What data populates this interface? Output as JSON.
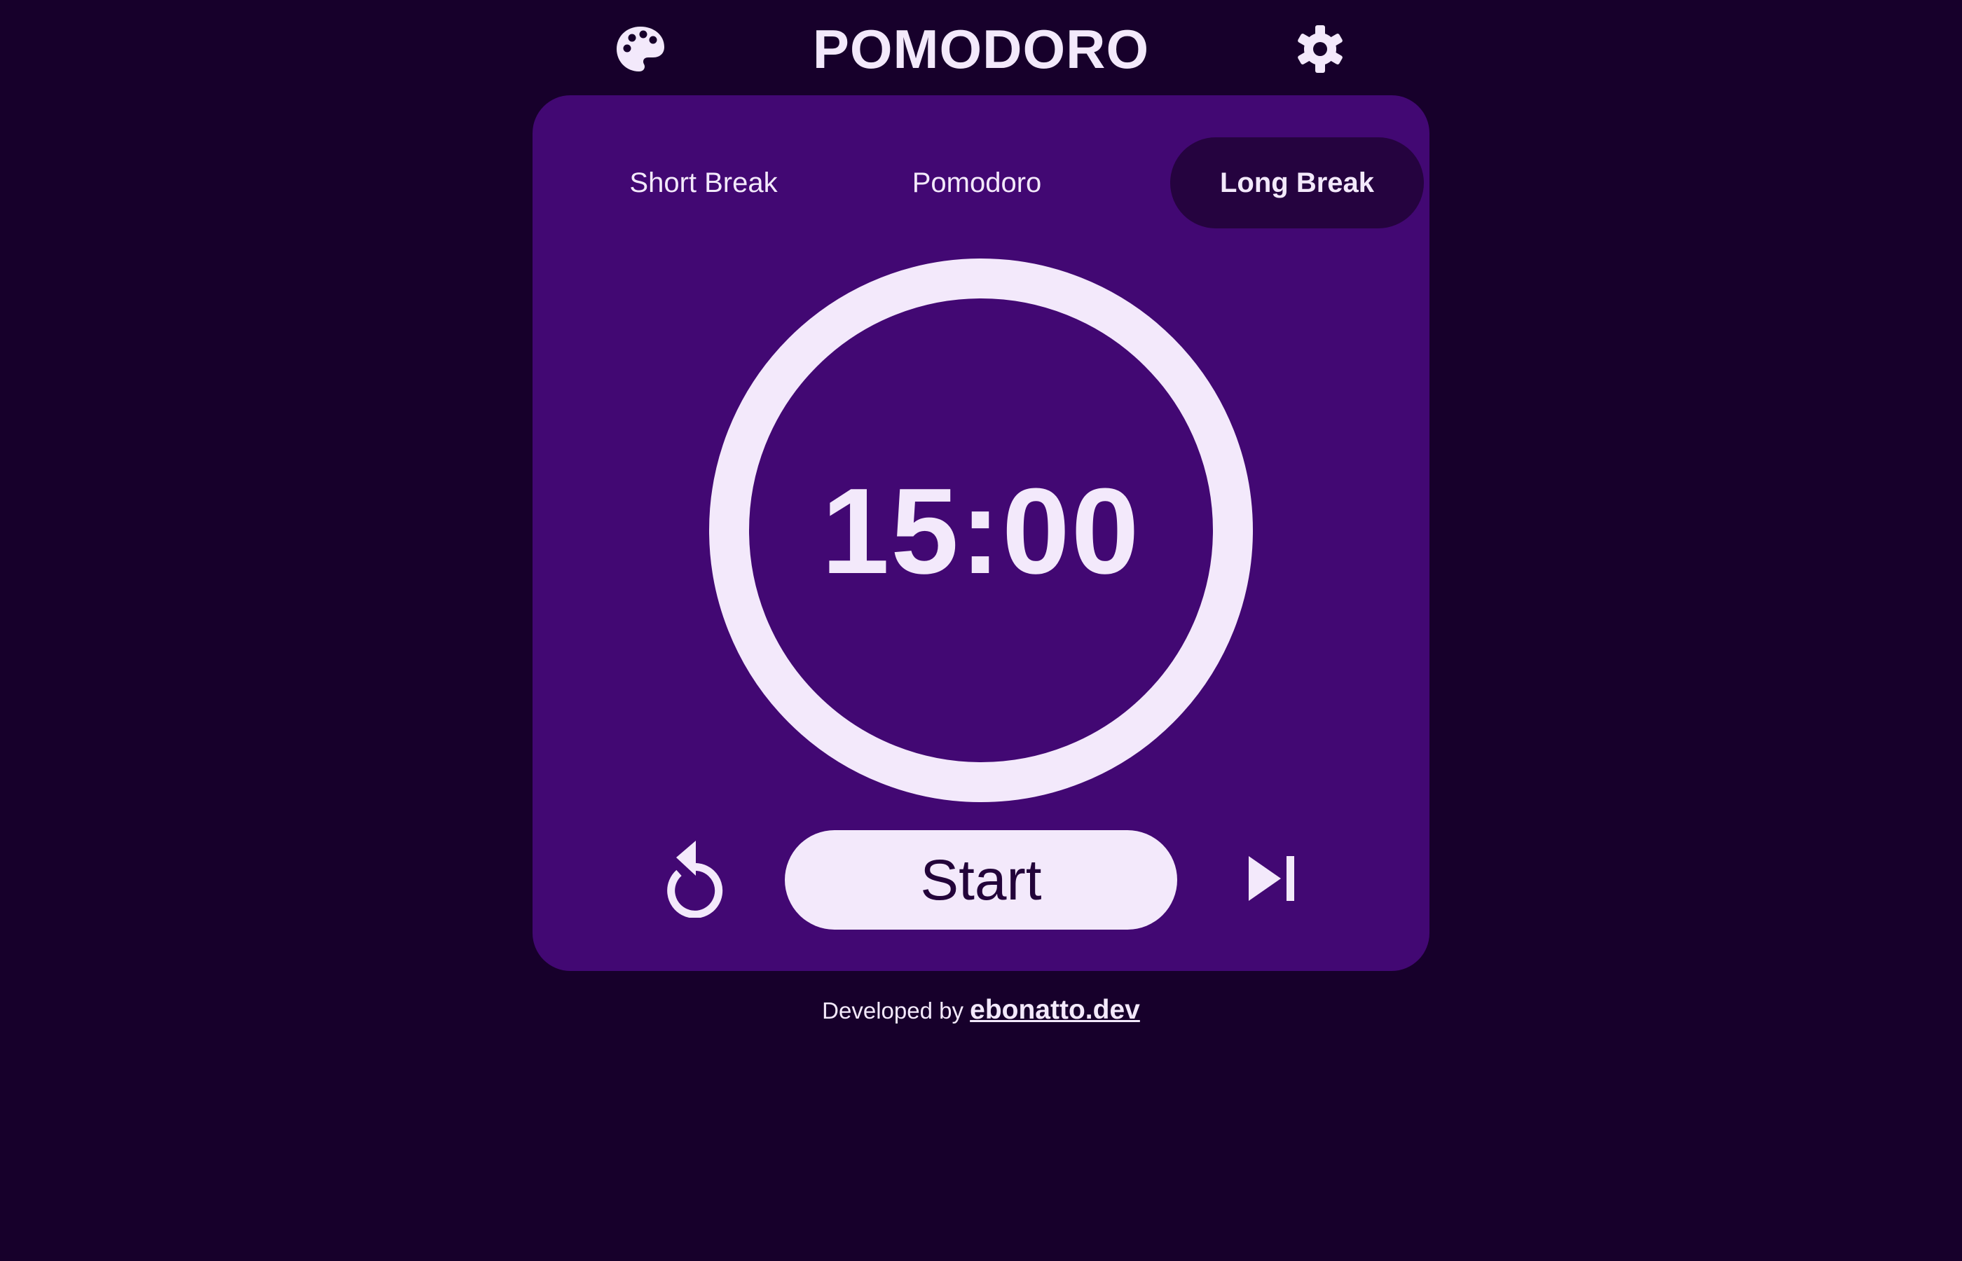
{
  "header": {
    "title": "POMODORO",
    "left_icon": "palette-icon",
    "right_icon": "gear-icon"
  },
  "tabs": [
    {
      "label": "Short Break",
      "active": false
    },
    {
      "label": "Pomodoro",
      "active": false
    },
    {
      "label": "Long Break",
      "active": true
    }
  ],
  "timer": {
    "time": "15:00",
    "progress": 1.0
  },
  "controls": {
    "reset_icon": "reset-icon",
    "start_label": "Start",
    "skip_icon": "skip-next-icon"
  },
  "footer": {
    "prefix": "Developed by",
    "link_text": "ebonatto.dev"
  },
  "colors": {
    "background": "#17002b",
    "card": "#420873",
    "active_tab": "#25033f",
    "foreground": "#f3e9fb",
    "button_text": "#23043a"
  }
}
